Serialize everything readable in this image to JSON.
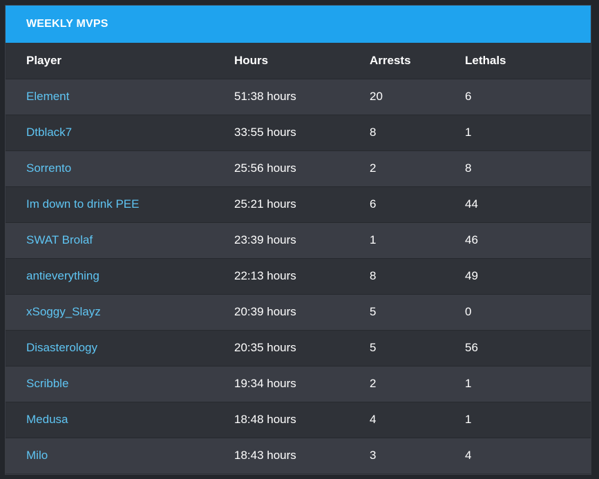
{
  "panel": {
    "title": "WEEKLY MVPS"
  },
  "table": {
    "columns": [
      "Player",
      "Hours",
      "Arrests",
      "Lethals"
    ],
    "rows": [
      {
        "player": "Element",
        "hours": "51:38 hours",
        "arrests": "20",
        "lethals": "6"
      },
      {
        "player": "Dtblack7",
        "hours": "33:55 hours",
        "arrests": "8",
        "lethals": "1"
      },
      {
        "player": "Sorrento",
        "hours": "25:56 hours",
        "arrests": "2",
        "lethals": "8"
      },
      {
        "player": "Im down to drink PEE",
        "hours": "25:21 hours",
        "arrests": "6",
        "lethals": "44"
      },
      {
        "player": "SWAT Brolaf",
        "hours": "23:39 hours",
        "arrests": "1",
        "lethals": "46"
      },
      {
        "player": "antieverything",
        "hours": "22:13 hours",
        "arrests": "8",
        "lethals": "49"
      },
      {
        "player": "xSoggy_Slayz",
        "hours": "20:39 hours",
        "arrests": "5",
        "lethals": "0"
      },
      {
        "player": "Disasterology",
        "hours": "20:35 hours",
        "arrests": "5",
        "lethals": "56"
      },
      {
        "player": "Scribble",
        "hours": "19:34 hours",
        "arrests": "2",
        "lethals": "1"
      },
      {
        "player": "Medusa",
        "hours": "18:48 hours",
        "arrests": "4",
        "lethals": "1"
      },
      {
        "player": "Milo",
        "hours": "18:43 hours",
        "arrests": "3",
        "lethals": "4"
      }
    ]
  },
  "colors": {
    "header_bg": "#1fa3ee",
    "panel_bg": "#2f3238",
    "row_alt_bg": "#3a3d45",
    "player_link": "#5fc5f3",
    "text": "#ffffff"
  }
}
